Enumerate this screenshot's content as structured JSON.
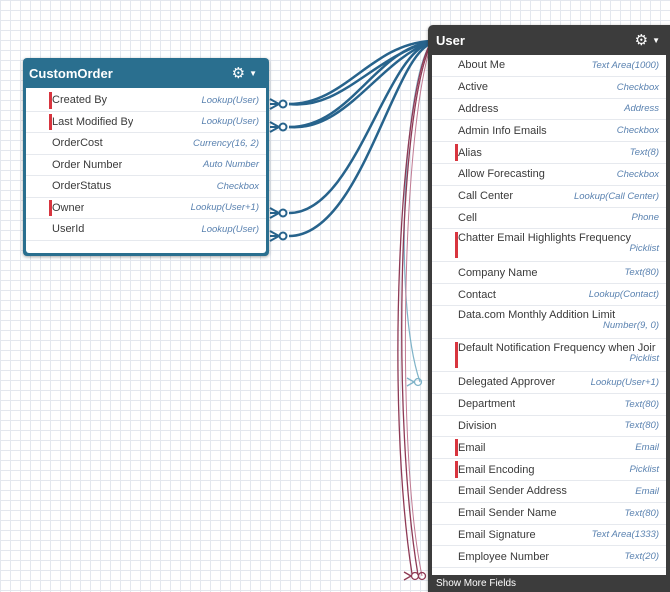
{
  "custom_order": {
    "title": "CustomOrder",
    "fields": [
      {
        "name": "Created By",
        "type": "Lookup(User)",
        "required": true
      },
      {
        "name": "Last Modified By",
        "type": "Lookup(User)",
        "required": true
      },
      {
        "name": "OrderCost",
        "type": "Currency(16, 2)",
        "required": false
      },
      {
        "name": "Order Number",
        "type": "Auto Number",
        "required": false
      },
      {
        "name": "OrderStatus",
        "type": "Checkbox",
        "required": false
      },
      {
        "name": "Owner",
        "type": "Lookup(User+1)",
        "required": true
      },
      {
        "name": "UserId",
        "type": "Lookup(User)",
        "required": false
      }
    ]
  },
  "user": {
    "title": "User",
    "footer": "Show More Fields",
    "fields": [
      {
        "name": "About Me",
        "type": "Text Area(1000)",
        "required": false
      },
      {
        "name": "Active",
        "type": "Checkbox",
        "required": false
      },
      {
        "name": "Address",
        "type": "Address",
        "required": false
      },
      {
        "name": "Admin Info Emails",
        "type": "Checkbox",
        "required": false
      },
      {
        "name": "Alias",
        "type": "Text(8)",
        "required": true
      },
      {
        "name": "Allow Forecasting",
        "type": "Checkbox",
        "required": false
      },
      {
        "name": "Call Center",
        "type": "Lookup(Call Center)",
        "required": false
      },
      {
        "name": "Cell",
        "type": "Phone",
        "required": false
      },
      {
        "name": "Chatter Email Highlights Frequency",
        "type": "Picklist",
        "required": true,
        "wrap": true
      },
      {
        "name": "Company Name",
        "type": "Text(80)",
        "required": false
      },
      {
        "name": "Contact",
        "type": "Lookup(Contact)",
        "required": false
      },
      {
        "name": "Data.com Monthly Addition Limit",
        "type": "Number(9, 0)",
        "required": false,
        "wrap": true
      },
      {
        "name": "Default Notification Frequency when Joir",
        "type": "Picklist",
        "required": true,
        "wrap": true
      },
      {
        "name": "Delegated Approver",
        "type": "Lookup(User+1)",
        "required": false
      },
      {
        "name": "Department",
        "type": "Text(80)",
        "required": false
      },
      {
        "name": "Division",
        "type": "Text(80)",
        "required": false
      },
      {
        "name": "Email",
        "type": "Email",
        "required": true
      },
      {
        "name": "Email Encoding",
        "type": "Picklist",
        "required": true
      },
      {
        "name": "Email Sender Address",
        "type": "Email",
        "required": false
      },
      {
        "name": "Email Sender Name",
        "type": "Text(80)",
        "required": false
      },
      {
        "name": "Email Signature",
        "type": "Text Area(1333)",
        "required": false
      },
      {
        "name": "Employee Number",
        "type": "Text(20)",
        "required": false
      }
    ]
  },
  "colors": {
    "custom_header": "#2a6f8f",
    "user_header": "#3c3c3c",
    "required_marker": "#d8353f",
    "relationship_line": "#27638c",
    "lookup_line": "#8e3a55",
    "self_lookup_line": "#7fb3c8",
    "type_text": "#5a82b0"
  },
  "icons": {
    "settings": "gear-icon",
    "menu": "chevron-down-icon",
    "crow_foot": "crows-foot-icon"
  }
}
